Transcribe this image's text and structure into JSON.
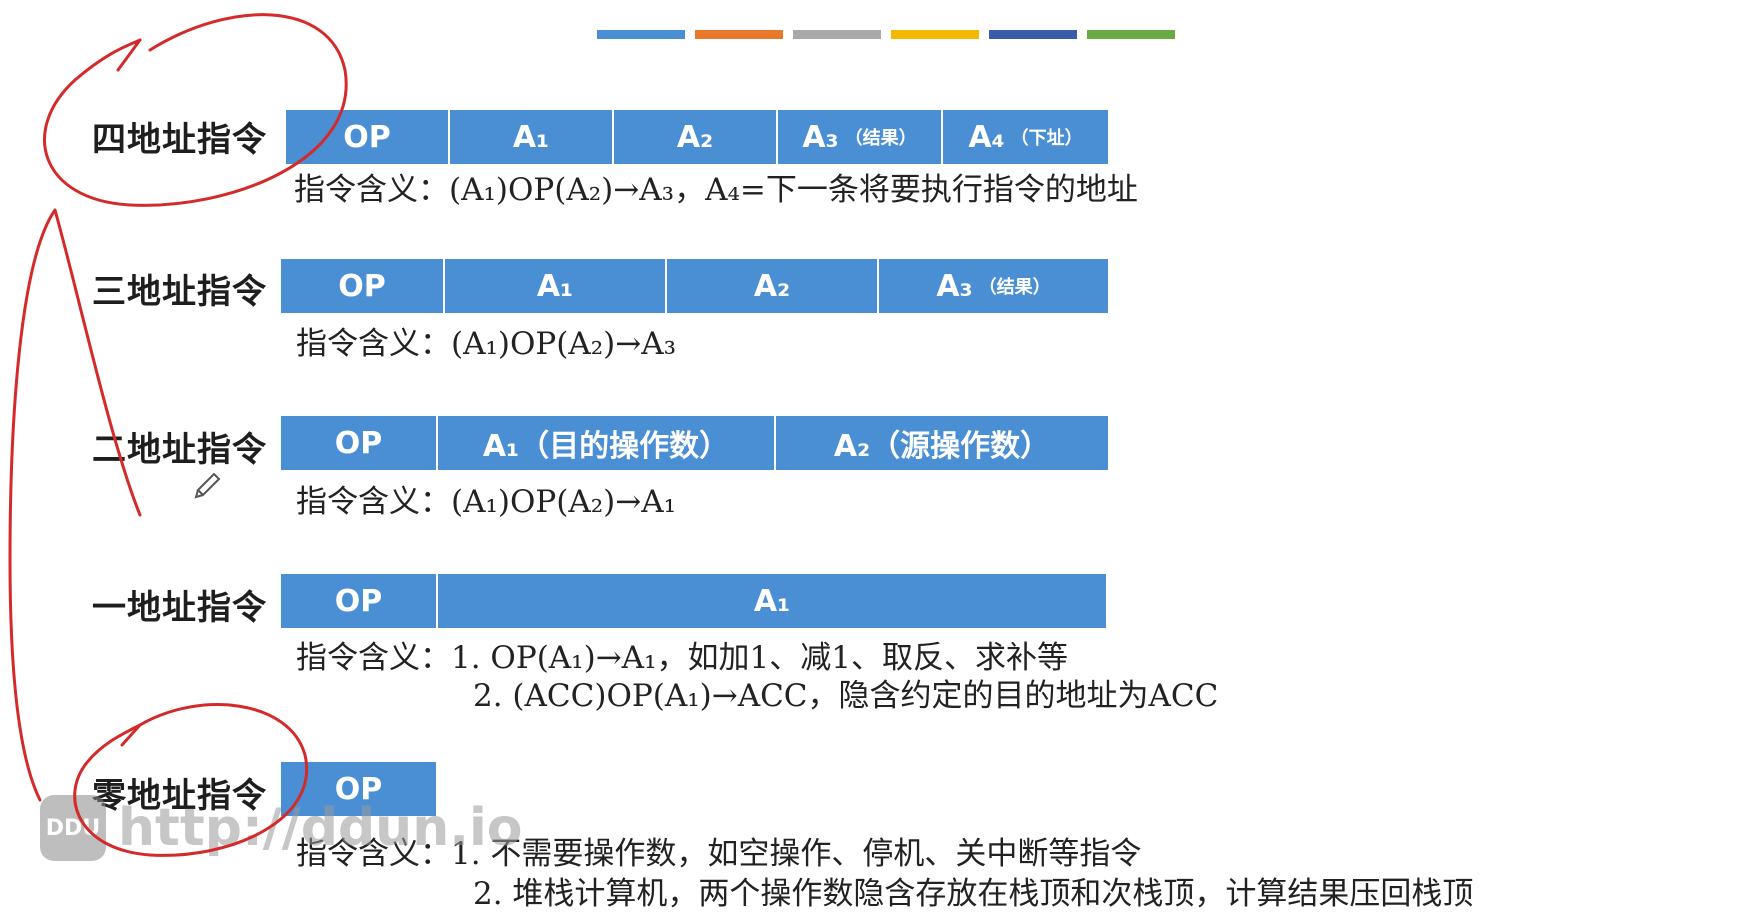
{
  "top_bar_colors": [
    "#4a8fd4",
    "#e8782a",
    "#a9a9a9",
    "#f5b800",
    "#3b5bab",
    "#6aaa44"
  ],
  "rows": {
    "four": {
      "label": "四地址指令",
      "cells": [
        {
          "main": "OP",
          "sub": ""
        },
        {
          "main": "A₁",
          "sub": ""
        },
        {
          "main": "A₂",
          "sub": ""
        },
        {
          "main": "A₃",
          "sub": "（结果）"
        },
        {
          "main": "A₄",
          "sub": "（下址）"
        }
      ],
      "meaning_label": "指令含义：",
      "meaning": "(A₁)OP(A₂)→A₃，A₄=下一条将要执行指令的地址"
    },
    "three": {
      "label": "三地址指令",
      "cells": [
        {
          "main": "OP",
          "sub": ""
        },
        {
          "main": "A₁",
          "sub": ""
        },
        {
          "main": "A₂",
          "sub": ""
        },
        {
          "main": "A₃",
          "sub": "（结果）"
        }
      ],
      "meaning_label": "指令含义：",
      "meaning": "(A₁)OP(A₂)→A₃"
    },
    "two": {
      "label": "二地址指令",
      "cells": [
        {
          "main": "OP",
          "sub": ""
        },
        {
          "main": "A₁（目的操作数）",
          "sub": ""
        },
        {
          "main": "A₂（源操作数）",
          "sub": ""
        }
      ],
      "meaning_label": "指令含义：",
      "meaning": "(A₁)OP(A₂)→A₁"
    },
    "one": {
      "label": "一地址指令",
      "cells": [
        {
          "main": "OP",
          "sub": ""
        },
        {
          "main": "A₁",
          "sub": ""
        }
      ],
      "meaning_label": "指令含义：",
      "meaning": "1. OP(A₁)→A₁，如加1、减1、取反、求补等",
      "meaning_line2": "2. (ACC)OP(A₁)→ACC，隐含约定的目的地址为ACC"
    },
    "zero": {
      "label": "零地址指令",
      "cells": [
        {
          "main": "OP",
          "sub": ""
        }
      ],
      "meaning_label": "指令含义：",
      "meaning": "1. 不需要操作数，如空操作、停机、关中断等指令",
      "meaning_line2": "2. 堆栈计算机，两个操作数隐含存放在栈顶和次栈顶，计算结果压回栈顶"
    }
  },
  "watermark": {
    "logo": "DDU",
    "text": "http://ddun.io"
  },
  "annotation_color": "#d42a2a"
}
